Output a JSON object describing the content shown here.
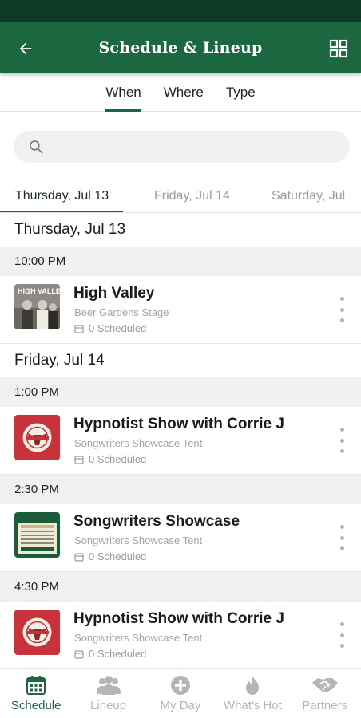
{
  "header": {
    "title": "Schedule & Lineup"
  },
  "filter_tabs": [
    {
      "label": "When",
      "active": true
    },
    {
      "label": "Where",
      "active": false
    },
    {
      "label": "Type",
      "active": false
    }
  ],
  "search": {
    "placeholder": ""
  },
  "date_tabs": [
    {
      "label": "Thursday, Jul 13",
      "active": true
    },
    {
      "label": "Friday, Jul 14",
      "active": false
    },
    {
      "label": "Saturday, Jul",
      "active": false
    }
  ],
  "days": [
    {
      "label": "Thursday, Jul 13",
      "slots": [
        {
          "time": "10:00 PM",
          "title": "High Valley",
          "venue": "Beer Gardens Stage",
          "scheduled": "0 Scheduled",
          "thumb": "high-valley"
        }
      ]
    },
    {
      "label": "Friday, Jul 14",
      "slots": [
        {
          "time": "1:00 PM",
          "title": "Hypnotist Show with Corrie J",
          "venue": "Songwriters Showcase Tent",
          "scheduled": "0 Scheduled",
          "thumb": "bull-logo"
        },
        {
          "time": "2:30 PM",
          "title": "Songwriters Showcase",
          "venue": "Songwriters Showcase Tent",
          "scheduled": "0 Scheduled",
          "thumb": "songwriters-poster"
        },
        {
          "time": "4:30 PM",
          "title": "Hypnotist Show with Corrie J",
          "venue": "Songwriters Showcase Tent",
          "scheduled": "0 Scheduled",
          "thumb": "bull-logo"
        }
      ]
    }
  ],
  "thumb_text": {
    "high_valley": "HIGH VALLEY"
  },
  "bottom_nav": [
    {
      "label": "Schedule",
      "icon": "calendar-icon",
      "active": true
    },
    {
      "label": "Lineup",
      "icon": "people-icon",
      "active": false
    },
    {
      "label": "My Day",
      "icon": "plus-circle-icon",
      "active": false
    },
    {
      "label": "What's Hot",
      "icon": "flame-icon",
      "active": false
    },
    {
      "label": "Partners",
      "icon": "handshake-icon",
      "active": false
    }
  ],
  "colors": {
    "primary": "#1b6740",
    "status_bar": "#0f3b26",
    "inactive": "#b5b5b5",
    "time_header_bg": "#f0f0f0"
  }
}
